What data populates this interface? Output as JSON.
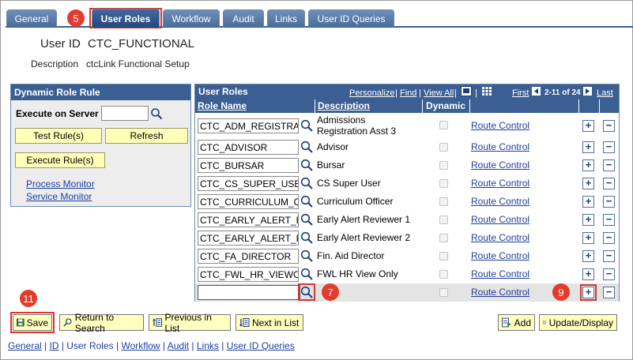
{
  "tabs": [
    {
      "label": "General"
    },
    {
      "label": "User Roles"
    },
    {
      "label": "Workflow"
    },
    {
      "label": "Audit"
    },
    {
      "label": "Links"
    },
    {
      "label": "User ID Queries"
    }
  ],
  "callouts": {
    "c5": "5",
    "c7": "7",
    "c9": "9",
    "c11": "11"
  },
  "header": {
    "userid_label": "User ID",
    "userid_value": "CTC_FUNCTIONAL",
    "description_label": "Description",
    "description_value": "ctcLink Functional Setup"
  },
  "dynamic_rule": {
    "title": "Dynamic Role Rule",
    "execute_on_server_label": "Execute on Server",
    "execute_on_server_value": "",
    "test_rules_button": "Test Rule(s)",
    "refresh_button": "Refresh",
    "execute_rules_button": "Execute Rule(s)",
    "process_monitor_link": "Process Monitor",
    "service_monitor_link": "Service Monitor"
  },
  "user_roles": {
    "title": "User Roles",
    "personalize": "Personalize",
    "find": "Find",
    "view_all": "View All",
    "first": "First",
    "range": "2-11 of 24",
    "last": "Last",
    "col_role_name": "Role Name",
    "col_description": "Description",
    "col_dynamic": "Dynamic",
    "rows": [
      {
        "role": "CTC_ADM_REGISTRA",
        "description": "Admissions Registration Asst 3",
        "route": "Route Control"
      },
      {
        "role": "CTC_ADVISOR",
        "description": "Advisor",
        "route": "Route Control"
      },
      {
        "role": "CTC_BURSAR",
        "description": "Bursar",
        "route": "Route Control"
      },
      {
        "role": "CTC_CS_SUPER_USE",
        "description": "CS Super User",
        "route": "Route Control"
      },
      {
        "role": "CTC_CURRICULUM_O",
        "description": "Curriculum Officer",
        "route": "Route Control"
      },
      {
        "role": "CTC_EARLY_ALERT_R",
        "description": "Early Alert Reviewer 1",
        "route": "Route Control"
      },
      {
        "role": "CTC_EARLY_ALERT_R",
        "description": "Early Alert Reviewer 2",
        "route": "Route Control"
      },
      {
        "role": "CTC_FA_DIRECTOR",
        "description": "Fin. Aid Director",
        "route": "Route Control"
      },
      {
        "role": "CTC_FWL_HR_VIEWO",
        "description": "FWL HR View Only",
        "route": "Route Control"
      },
      {
        "role": "",
        "description": "",
        "route": "Route Control"
      }
    ],
    "add_symbol": "+",
    "remove_symbol": "−"
  },
  "toolbar": {
    "save": "Save",
    "return_to_search": "Return to Search",
    "previous_in_list": "Previous in List",
    "next_in_list": "Next in List",
    "add": "Add",
    "update_display": "Update/Display"
  },
  "bottom_links": [
    "General",
    "ID",
    "User Roles",
    "Workflow",
    "Audit",
    "Links",
    "User ID Queries"
  ],
  "icons": {
    "lookup": "magnifier-icon",
    "first_arrow": "left-arrow-icon",
    "last_arrow": "right-arrow-icon",
    "save": "floppy-disk-icon"
  },
  "colors": {
    "header_blue": "#3b5f93",
    "tab_blue": "#4a6d9c",
    "callout_red": "#e13c2c",
    "button_yellow": "#ffffc0",
    "link_blue": "#1f3f9f"
  }
}
